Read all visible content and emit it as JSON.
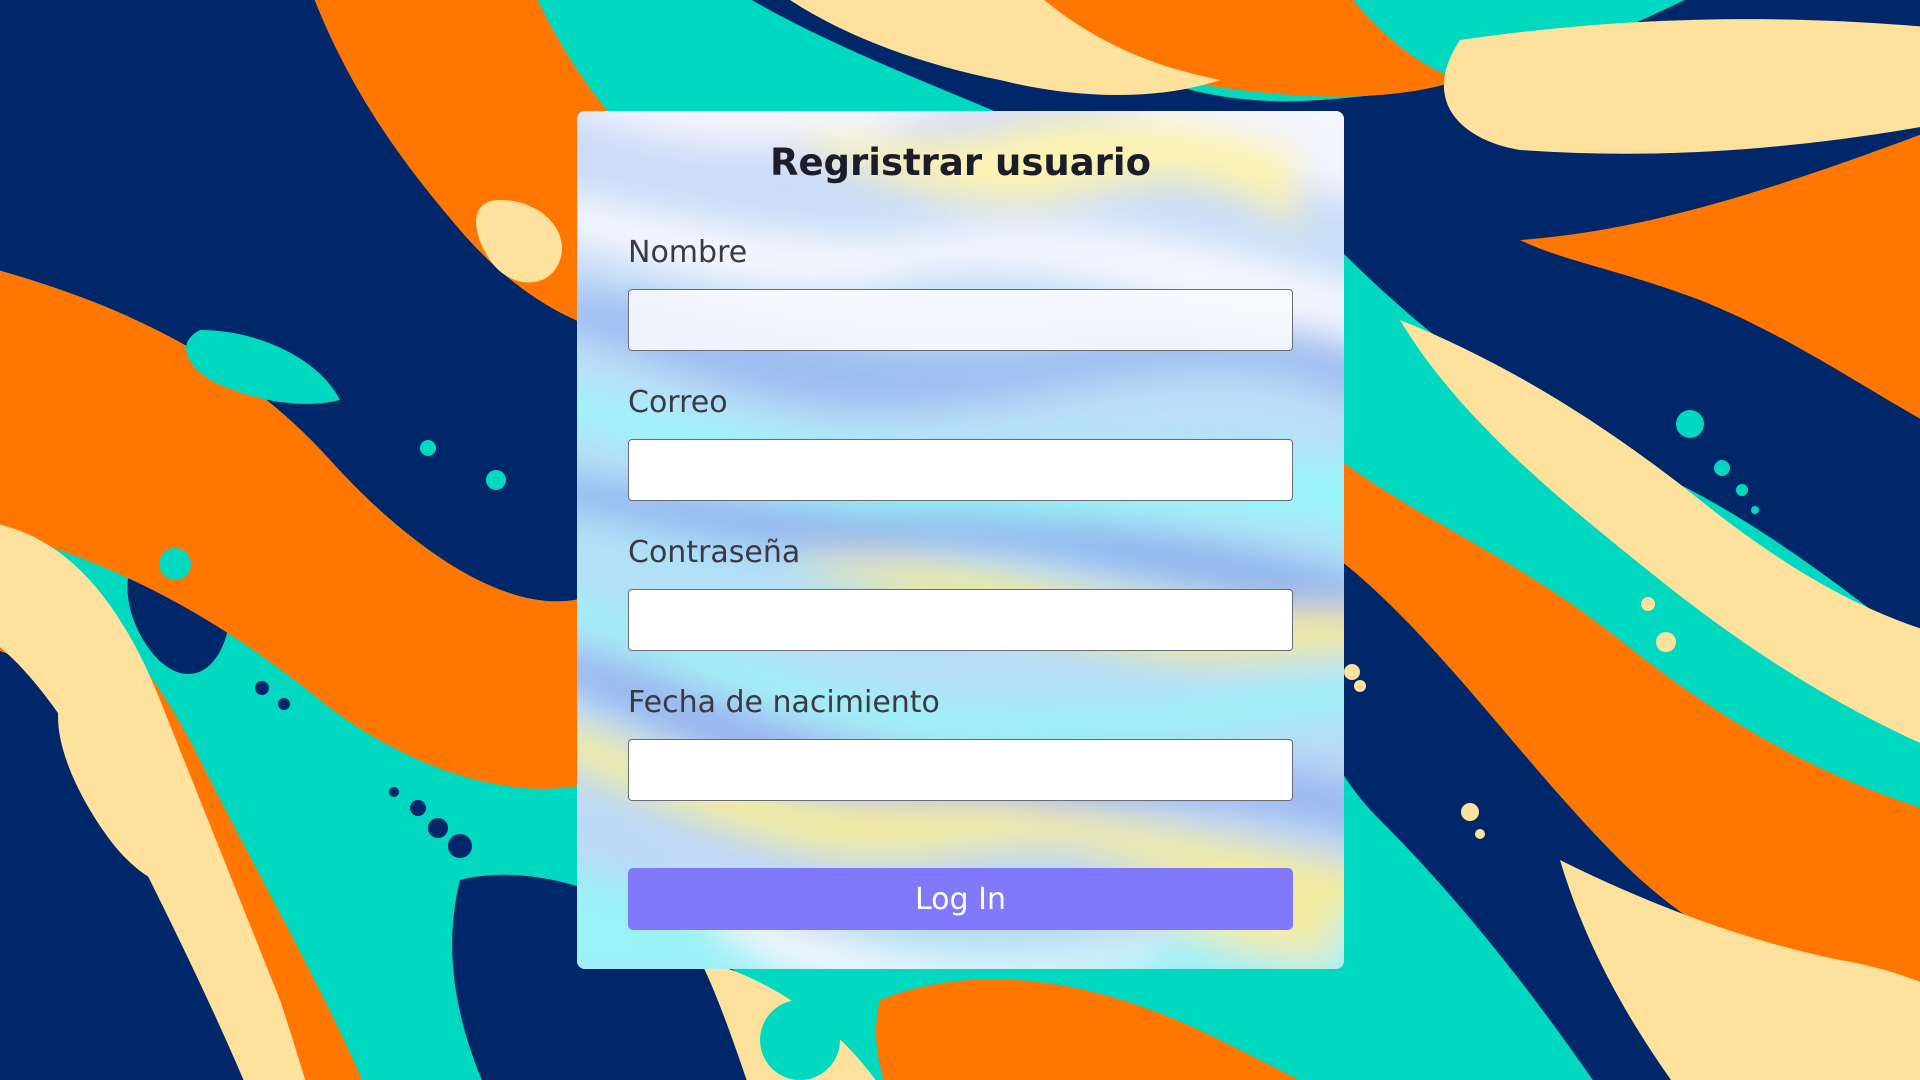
{
  "theme": {
    "navy": "#002769",
    "orange": "#ff7700",
    "cream": "#ffe19e",
    "teal": "#00d9c0",
    "button": "#8079fb"
  },
  "form": {
    "title": "Regristrar usuario",
    "fields": [
      {
        "label": "Nombre",
        "value": "",
        "type": "text"
      },
      {
        "label": "Correo",
        "value": "",
        "type": "email"
      },
      {
        "label": "Contraseña",
        "value": "",
        "type": "password"
      },
      {
        "label": "Fecha de nacimiento",
        "value": "",
        "type": "text"
      }
    ],
    "submit_label": "Log In"
  }
}
